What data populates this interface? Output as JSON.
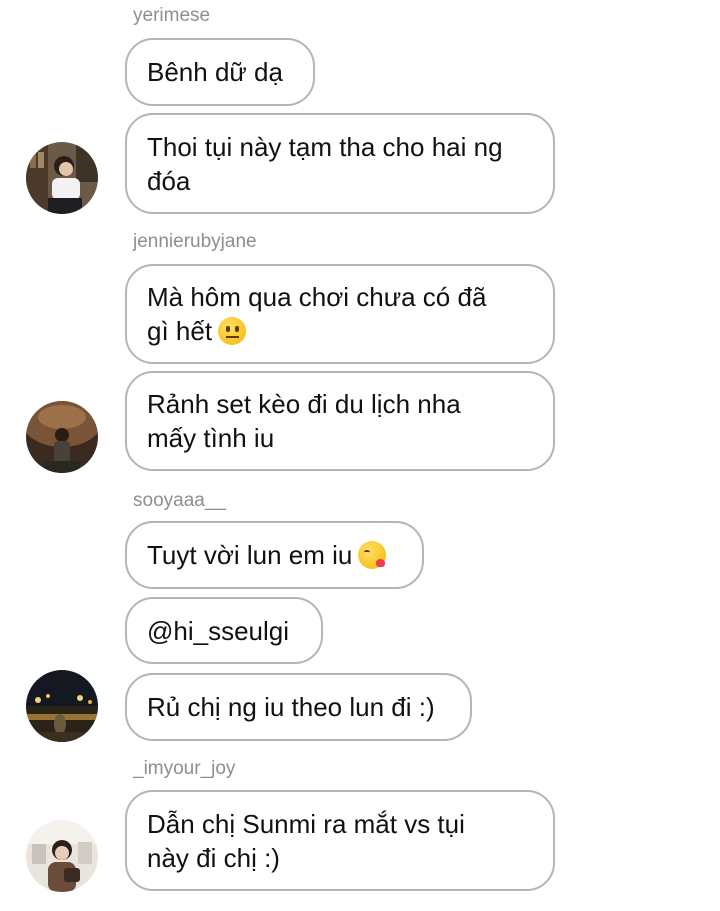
{
  "chat": {
    "groups": [
      {
        "username": "yerimese",
        "messages": [
          {
            "text": "Bênh dữ dạ"
          },
          {
            "text": "Thoi tụi này tạm tha cho hai ng\nđóa"
          }
        ]
      },
      {
        "username": "jennierubyjane",
        "messages": [
          {
            "text": "Mà hôm qua chơi chưa có đã\ngì hết",
            "emoji": "neutral-face-emoji"
          },
          {
            "text": "Rảnh set kèo đi du lịch nha\nmấy tình iu"
          }
        ]
      },
      {
        "username": "sooyaaa__",
        "messages": [
          {
            "text": "Tuyt vời lun em iu",
            "emoji": "kissing-face-emoji"
          },
          {
            "text": "@hi_sseulgi"
          },
          {
            "text": "Rủ chị ng iu theo lun đi :)"
          }
        ]
      },
      {
        "username": "_imyour_joy",
        "messages": [
          {
            "text": "Dẫn chị Sunmi ra mắt vs tụi\nnày đi chị :)"
          }
        ]
      }
    ]
  },
  "colors": {
    "bubble_border": "#b5b5b5",
    "username_text": "#8e8e8e",
    "message_text": "#111111",
    "background": "#ffffff"
  }
}
